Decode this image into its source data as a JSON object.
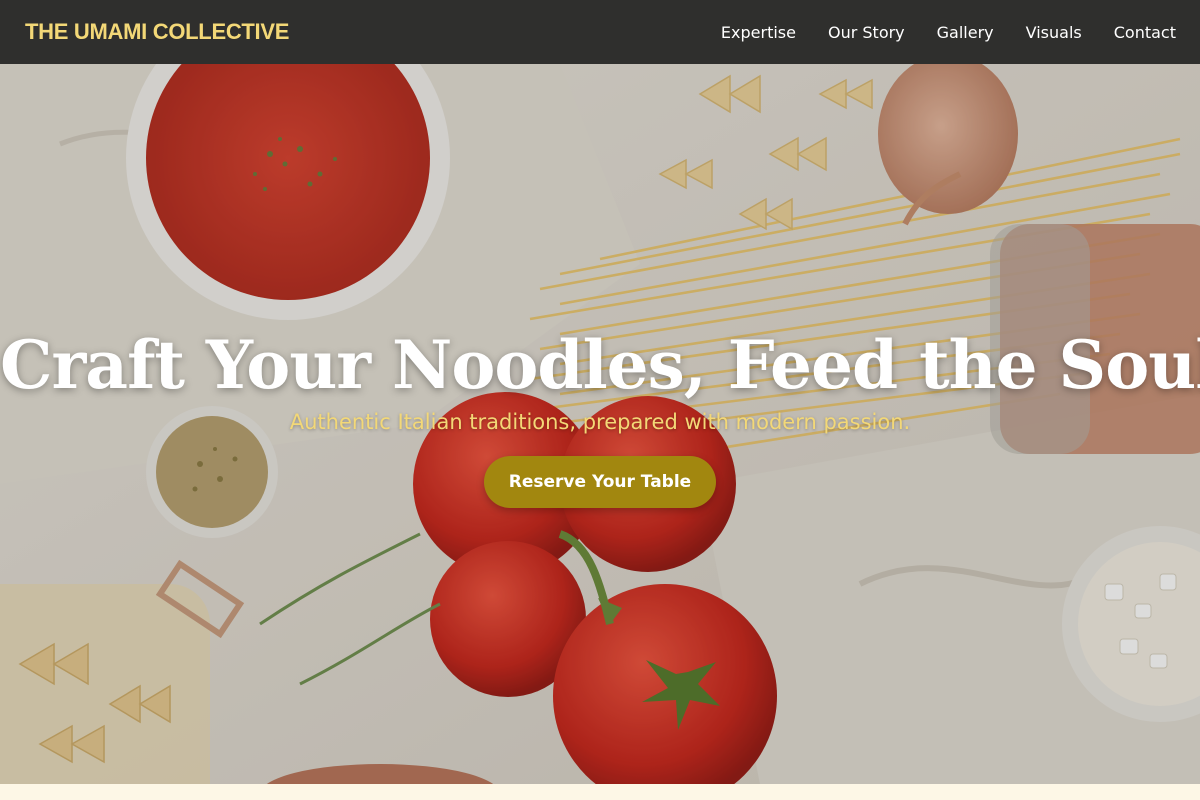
{
  "header": {
    "brand": "THE UMAMI COLLECTIVE",
    "nav": [
      {
        "label": "Expertise"
      },
      {
        "label": "Our Story"
      },
      {
        "label": "Gallery"
      },
      {
        "label": "Visuals"
      },
      {
        "label": "Contact"
      }
    ]
  },
  "hero": {
    "title": "Craft Your Noodles, Feed the Soul.",
    "subtitle": "Authentic Italian traditions, prepared with modern passion.",
    "cta_label": "Reserve Your Table"
  },
  "colors": {
    "nav_bg": "#2f2f2d",
    "brand_accent": "#f3d877",
    "cta_bg": "#a2870f",
    "page_bg": "#fdf7e6"
  }
}
